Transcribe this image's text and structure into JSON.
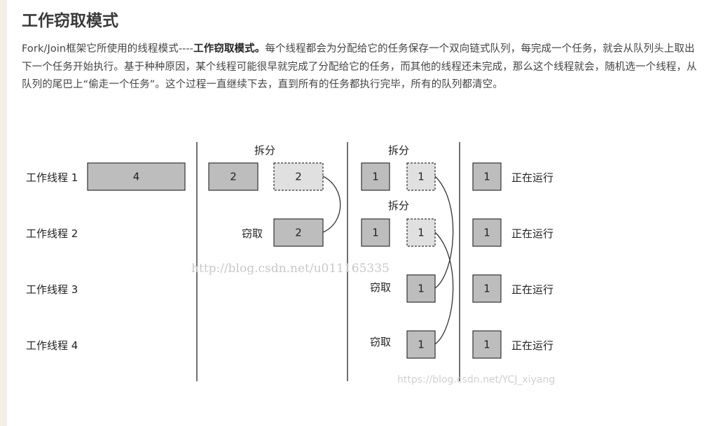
{
  "article": {
    "title": "工作窃取模式",
    "paragraph_pre": "Fork/Join框架它所使用的线程模式----",
    "paragraph_bold": "工作窃取模式。",
    "paragraph_post": "每个线程都会为分配给它的任务保存一个双向链式队列，每完成一个任务，就会从队列头上取出下一个任务开始执行。基于种种原因，某个线程可能很早就完成了分配给它的任务，而其他的线程还未完成，那么这个线程就会，随机选一个线程，从队列的尾巴上“偷走一个任务”。这个过程一直继续下去，直到所有的任务都执行完毕，所有的队列都清空。"
  },
  "diagram": {
    "threads": [
      "工作线程 1",
      "工作线程 2",
      "工作线程 3",
      "工作线程 4"
    ],
    "split_label": "拆分",
    "steal_label": "窃取",
    "running_label": "正在运行",
    "col1": {
      "task": "4"
    },
    "col2": {
      "row1_task": "2",
      "row1_split": "2",
      "row2_stolen": "2"
    },
    "col3": {
      "row1_task": "1",
      "row1_split": "1",
      "row2_task": "1",
      "row2_split": "1",
      "row3_stolen": "1",
      "row4_stolen": "1"
    },
    "col4": {
      "tasks": [
        "1",
        "1",
        "1",
        "1"
      ]
    },
    "colors": {
      "task_fill": "#bdbdbd",
      "split_fill": "#e0e0e0",
      "stroke": "#333333"
    }
  },
  "watermarks": {
    "center": "http://blog.csdn.net/u011165335",
    "bottom": "https://blog.csdn.net/YCJ_xiyang"
  }
}
